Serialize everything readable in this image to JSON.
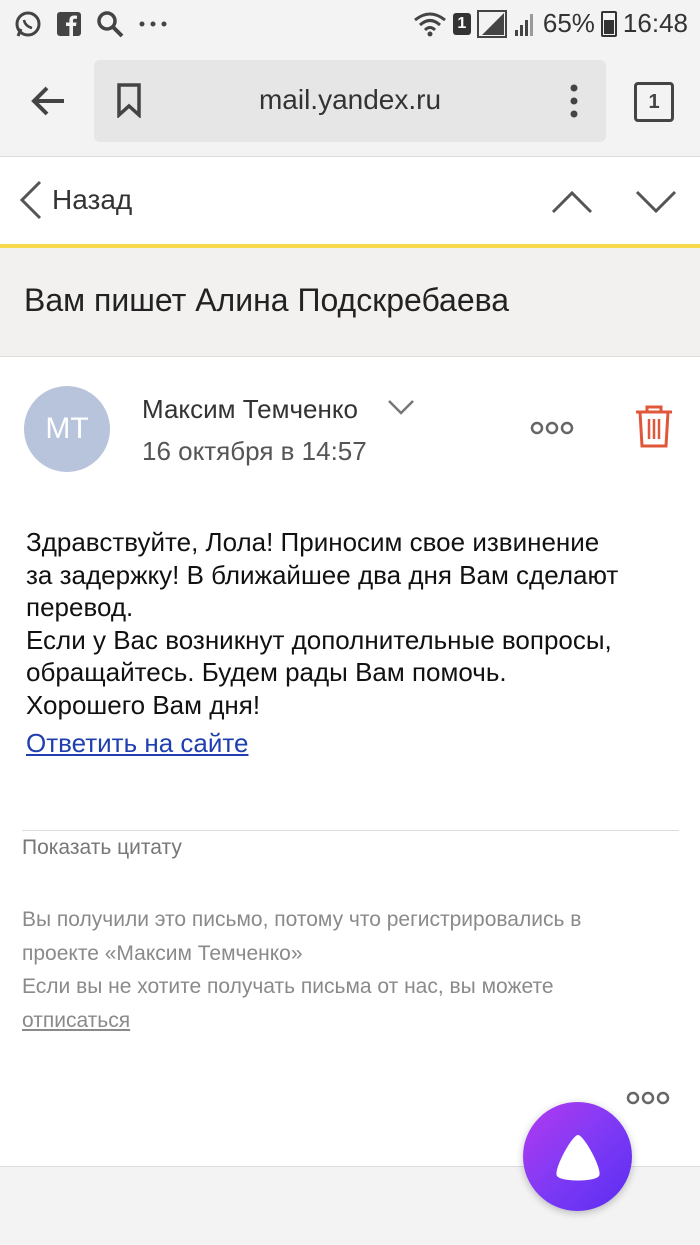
{
  "status_bar": {
    "notification_count": "1",
    "battery": "65%",
    "time": "16:48"
  },
  "browser": {
    "url": "mail.yandex.ru",
    "tab_count": "1"
  },
  "nav": {
    "back_label": "Назад"
  },
  "subject": "Вам пишет Алина Подскребаева",
  "sender": {
    "initials": "МТ",
    "name": "Максим Темченко",
    "date": "16 октября в 14:57"
  },
  "message": {
    "lines": [
      "Здравствуйте, Лола! Приносим свое извинение",
      "за задержку! В ближайшее два дня Вам сделают",
      "перевод.",
      "Если у Вас возникнут дополнительные вопросы,",
      "обращайтесь. Будем рады Вам помочь.",
      "Хорошего Вам дня!"
    ],
    "reply_link": "Ответить на сайте"
  },
  "quote_link": "Показать цитату",
  "footer": {
    "line1": "Вы получили это письмо, потому что регистрировались в",
    "line2": "проекте «Максим Темченко»",
    "line3": "Если вы не хотите получать письма от нас, вы можете",
    "unsubscribe": "отписаться"
  },
  "colors": {
    "accent_yellow": "#f7d94c",
    "delete_red": "#e0573a",
    "link_blue": "#1f3fb0",
    "avatar_bg": "#b8c3dc"
  }
}
